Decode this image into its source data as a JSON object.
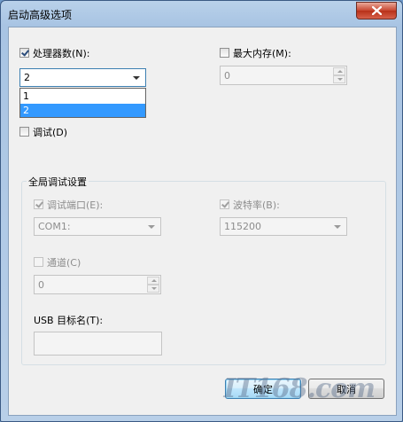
{
  "window": {
    "title": "启动高级选项",
    "close_icon": "close-icon"
  },
  "processors": {
    "label": "处理器数(N):",
    "checked": true,
    "value": "2",
    "options": [
      "1",
      "2"
    ],
    "selected_index": 1
  },
  "max_memory": {
    "label": "最大内存(M):",
    "checked": false,
    "value": "0"
  },
  "debug": {
    "label": "调试(D)",
    "checked": false
  },
  "global_debug": {
    "title": "全局调试设置",
    "port": {
      "label": "调试端口(E):",
      "checked": true,
      "value": "COM1:"
    },
    "baud": {
      "label": "波特率(B):",
      "checked": true,
      "value": "115200"
    },
    "channel": {
      "label": "通道(C)",
      "checked": false,
      "value": "0"
    },
    "usb_target": {
      "label": "USB 目标名(T):",
      "value": ""
    }
  },
  "buttons": {
    "ok": "确定",
    "cancel": "取消"
  },
  "watermark": "IT168.com"
}
